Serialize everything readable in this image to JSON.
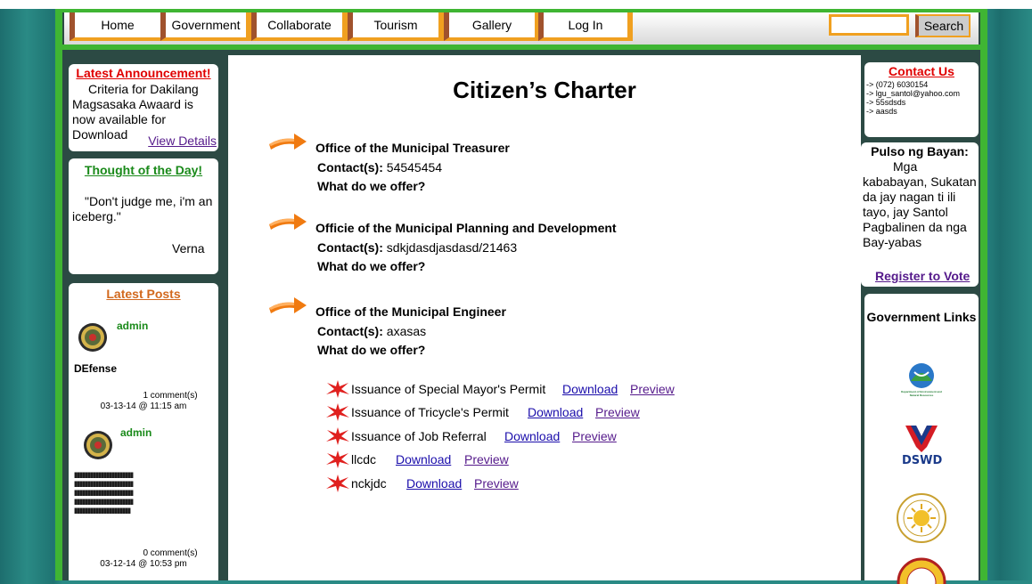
{
  "nav": {
    "items": [
      "Home",
      "Government",
      "Collaborate",
      "Tourism",
      "Gallery",
      "Log In"
    ],
    "search_label": "Search",
    "search_value": ""
  },
  "left": {
    "announcement": {
      "title": "Latest Announcement!",
      "text": "Criteria for Dakilang Magsasaka Awaard is now available for Download",
      "link": "View Details"
    },
    "thought": {
      "title": "Thought of the Day!",
      "quote": "\"Don't judge me, i'm an iceberg.\"",
      "author": "Verna"
    },
    "posts": {
      "title": "Latest Posts",
      "items": [
        {
          "author": "admin",
          "title": "DEfense",
          "body": "",
          "comments": "1 comment(s)",
          "date": "03-13-14 @ 11:15 am"
        },
        {
          "author": "admin",
          "title": "",
          "body": "IIIIIIIIIIIIIIIIIIIIIIIIIIIIIIIIIIIIIIIIIIII\nIIIIIIIIIIIIIIIIIIIIIIIIIIIIIIIIIIIIIIIIIIII\nIIIIIIIIIIIIIIIIIIIIIIIIIIIIIIIIIIIIIIIIIIII\nIIIIIIIIIIIIIIIIIIIIIIIIIIIIIIIIIIIIIIIIIIII\nIIIIIIIIIIIIIIIIIIIIIIIIIIIIIIIIIIIIIIIIII",
          "comments": "0 comment(s)",
          "date": "03-12-14 @ 10:53 pm"
        }
      ]
    }
  },
  "main": {
    "title": "Citizen’s Charter",
    "offices": [
      {
        "name": "Office of the Municipal Treasurer",
        "contact_label": "Contact(s):",
        "contact": "54545454",
        "offer": "What do we offer?"
      },
      {
        "name": "Officie of the Municipal Planning and Development",
        "contact_label": "Contact(s):",
        "contact": "sdkjdasdjasdasd/21463",
        "offer": "What do we offer?"
      },
      {
        "name": "Office of the Municipal Engineer",
        "contact_label": "Contact(s):",
        "contact": "axasas",
        "offer": "What do we offer?"
      }
    ],
    "permits": [
      {
        "name": "Issuance of Special Mayor's Permit",
        "download": "Download",
        "preview": "Preview"
      },
      {
        "name": "Issuance of Tricycle's Permit",
        "download": "Download",
        "preview": "Preview"
      },
      {
        "name": "Issuance of Job Referral",
        "download": "Download",
        "preview": "Preview"
      },
      {
        "name": "llcdc",
        "download": "Download",
        "preview": "Preview"
      },
      {
        "name": "nckjdc",
        "download": "Download",
        "preview": "Preview"
      }
    ]
  },
  "right": {
    "contact": {
      "title": "Contact Us",
      "lines": [
        "-> (072) 6030154",
        "-> lgu_santol@yahoo.com",
        "-> 55sdsds",
        "-> aasds"
      ]
    },
    "pulso": {
      "title": "Pulso ng Bayan:",
      "text": "Mga kababayan, Sukatan da jay nagan ti ili tayo, jay Santol Pagbalinen da nga Bay-yabas",
      "link": "Register to Vote"
    },
    "gov_links": {
      "title": "Government Links",
      "denr_caption": "Department of Environment and Natural Resources",
      "dswd_caption": "DSWD"
    }
  },
  "colors": {
    "accent_orange": "#f0a020",
    "frame_green": "#3fb533",
    "bg_teal": "#2a8a85",
    "panel_dark": "#2c4a44",
    "announcement_red": "#e00000",
    "thought_green": "#1a8a1a",
    "posts_orange": "#d2691e"
  },
  "icons": [
    "arrow-icon",
    "star-icon",
    "seal-icon",
    "denr-logo-icon",
    "dswd-logo-icon",
    "tourism-seal-icon"
  ]
}
